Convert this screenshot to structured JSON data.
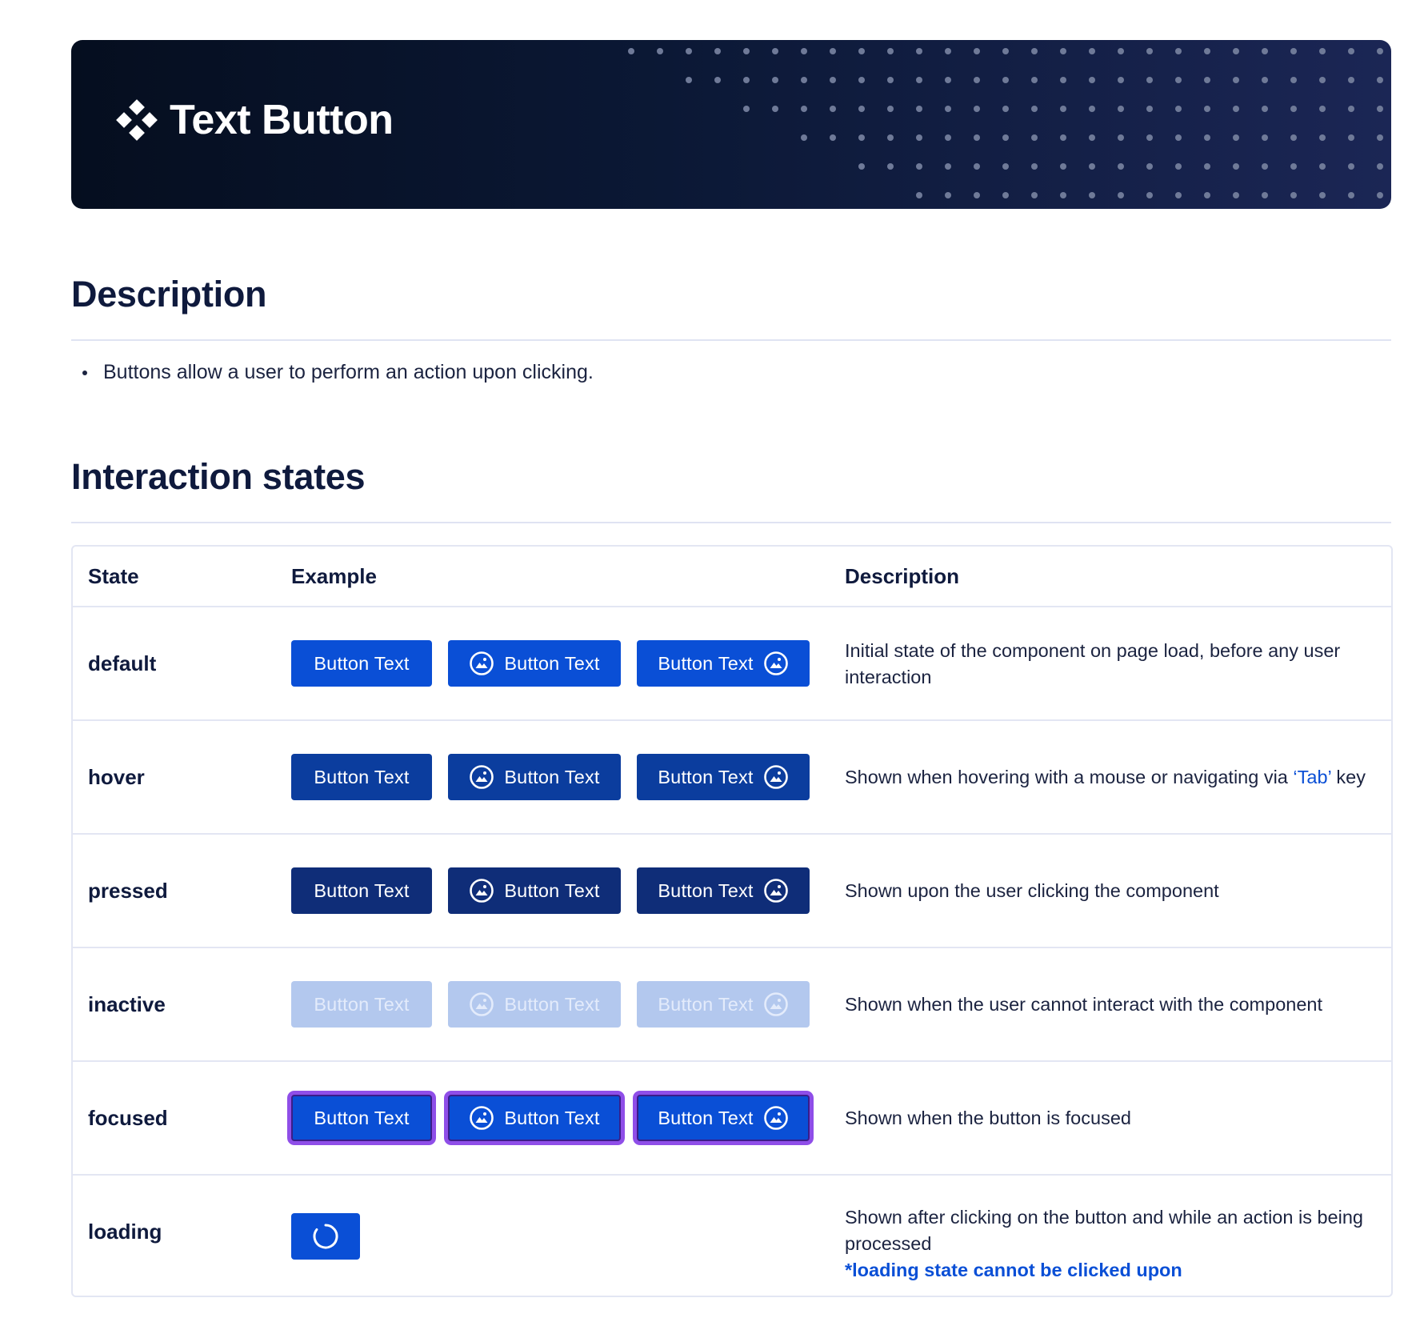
{
  "banner": {
    "title": "Text Button",
    "logo_icon": "diamond-cluster-icon"
  },
  "description_section": {
    "heading": "Description",
    "bullets": [
      "Buttons allow a user to perform an action upon clicking."
    ]
  },
  "states_section": {
    "heading": "Interaction states",
    "columns": [
      "State",
      "Example",
      "Description"
    ],
    "button_label": "Button Text",
    "button_icon": "image-circle-icon",
    "rows": [
      {
        "state": "default",
        "desc": "Initial state of the component on page load, before any user interaction"
      },
      {
        "state": "hover",
        "desc_pre": "Shown when hovering with a mouse or navigating via ",
        "desc_link": "‘Tab’",
        "desc_post": " key"
      },
      {
        "state": "pressed",
        "desc": "Shown upon the user clicking the component"
      },
      {
        "state": "inactive",
        "desc": "Shown when the user cannot interact with the component"
      },
      {
        "state": "focused",
        "desc": "Shown when the button is focused"
      },
      {
        "state": "loading",
        "desc": "Shown after clicking on the button and while an action is being processed",
        "note": "*loading state cannot be clicked upon",
        "spinner_icon": "spinner-icon"
      }
    ]
  },
  "colors": {
    "primary": "#0a4fd6",
    "hover": "#0b3d9e",
    "pressed": "#0f2d78",
    "inactive": "#b3c8ee",
    "focus_ring": "#8f4ee8"
  }
}
